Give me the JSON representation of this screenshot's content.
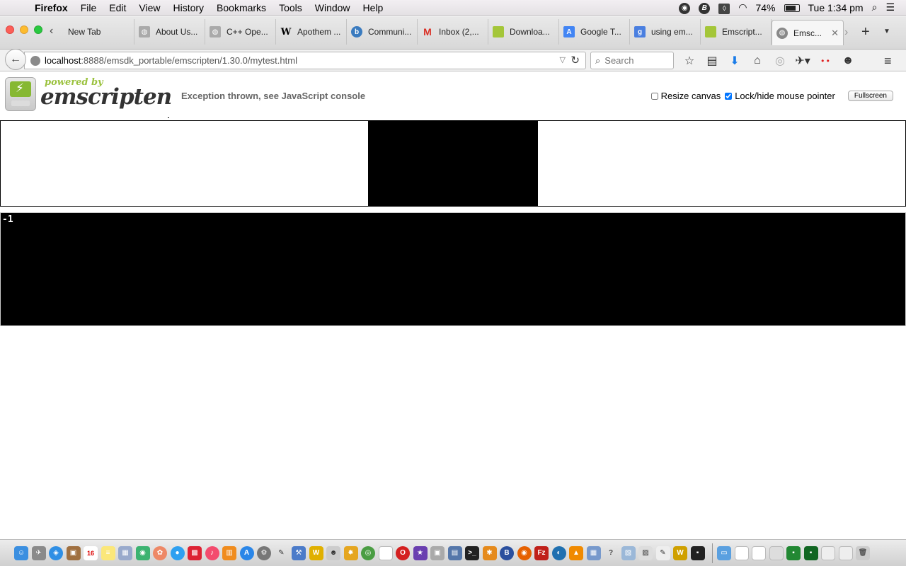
{
  "menubar": {
    "app": "Firefox",
    "items": [
      "File",
      "Edit",
      "View",
      "History",
      "Bookmarks",
      "Tools",
      "Window",
      "Help"
    ],
    "battery": "74%",
    "clock": "Tue 1:34 pm"
  },
  "tabs": [
    {
      "label": "New Tab",
      "icon": "none"
    },
    {
      "label": "About Us...",
      "icon": "globe-icon"
    },
    {
      "label": "C++ Ope...",
      "icon": "globe-icon"
    },
    {
      "label": "Apothem ...",
      "icon": "wikipedia-icon"
    },
    {
      "label": "Communi...",
      "icon": "site-icon"
    },
    {
      "label": "Inbox (2,...",
      "icon": "gmail-icon"
    },
    {
      "label": "Downloa...",
      "icon": "android-icon"
    },
    {
      "label": "Google T...",
      "icon": "google-translate-icon"
    },
    {
      "label": "using em...",
      "icon": "google-icon"
    },
    {
      "label": "Emscript...",
      "icon": "android-icon"
    },
    {
      "label": "Emsc...",
      "icon": "globe-icon"
    }
  ],
  "navbar": {
    "url_host": "localhost",
    "url_path": ":8888/emsdk_portable/emscripten/1.30.0/mytest.html",
    "search_placeholder": "Search"
  },
  "page": {
    "logo_powered": "powered by",
    "logo_name": "emscripten",
    "status": "Exception thrown, see JavaScript console",
    "resize_canvas_label": "Resize canvas",
    "resize_canvas_checked": false,
    "lock_pointer_label": "Lock/hide mouse pointer",
    "lock_pointer_checked": true,
    "fullscreen_label": "Fullscreen",
    "output": "-1"
  },
  "colors": {
    "emscripten_green": "#86b832",
    "canvas": "#000000",
    "output_bg": "#000000"
  }
}
